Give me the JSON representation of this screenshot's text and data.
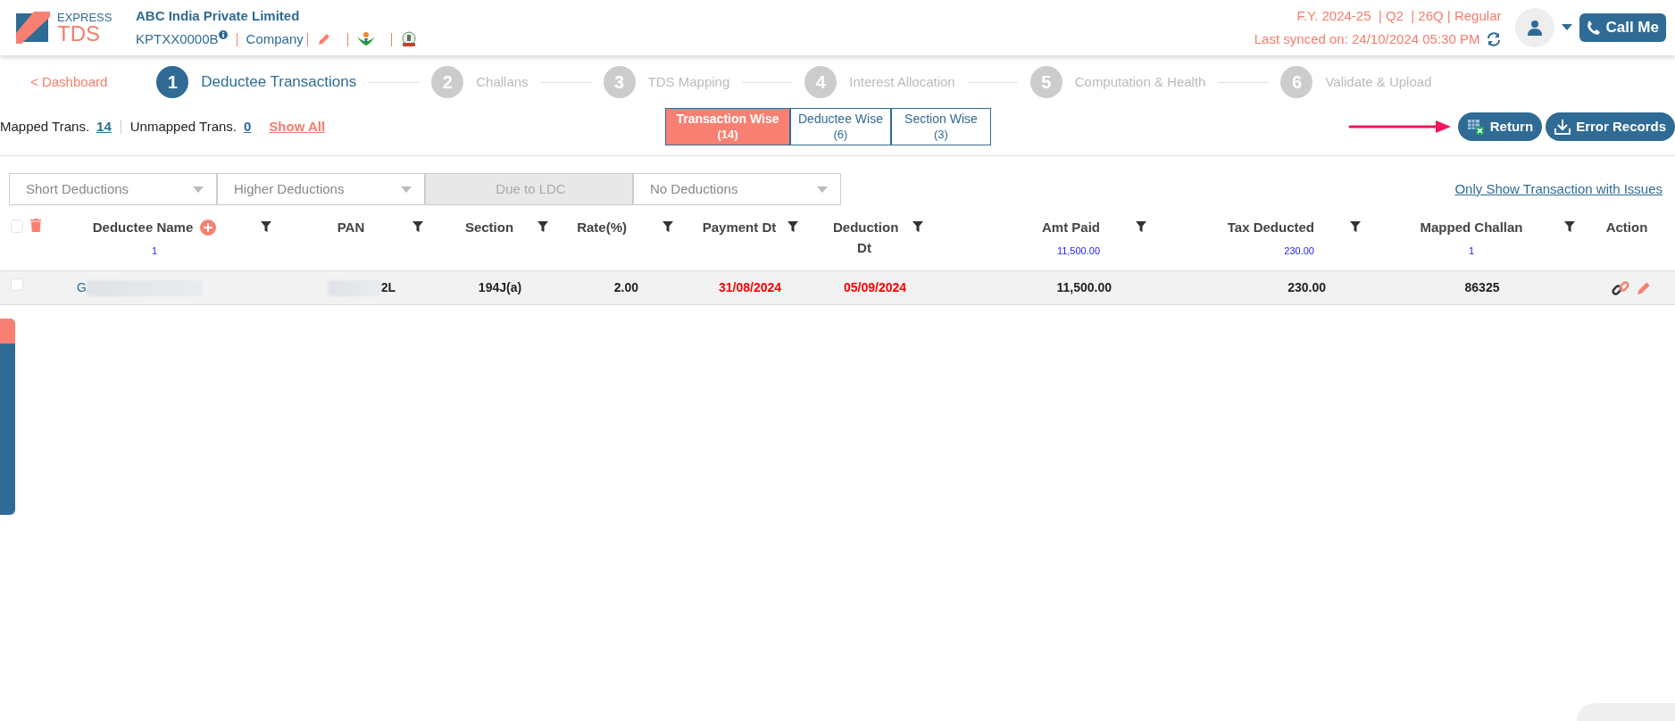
{
  "header": {
    "logo": {
      "top": "EXPRESS",
      "bottom": "TDS"
    },
    "company_name": "ABC India Private Limited",
    "tan": "KPTXX0000B",
    "entity_type": "Company",
    "return_info": "F.Y. 2024-25  | Q2  | 26Q | Regular",
    "last_synced": "Last synced on: 24/10/2024 05:30 PM",
    "call_button": "Call Me"
  },
  "stepper": {
    "back_link": "< Dashboard",
    "steps": [
      {
        "number": "1",
        "label": "Deductee Transactions",
        "selected": true
      },
      {
        "number": "2",
        "label": "Challans",
        "selected": false
      },
      {
        "number": "3",
        "label": "TDS Mapping",
        "selected": false
      },
      {
        "number": "4",
        "label": "Interest Allocation",
        "selected": false
      },
      {
        "number": "5",
        "label": "Computation & Health",
        "selected": false
      },
      {
        "number": "6",
        "label": "Validate & Upload",
        "selected": false
      }
    ]
  },
  "summary": {
    "mapped_label": "Mapped Trans.",
    "mapped_count": "14",
    "unmapped_label": "Unmapped Trans.",
    "unmapped_count": "0",
    "show_all": "Show All"
  },
  "view_tabs": [
    {
      "label": "Transaction Wise",
      "count": "(14)",
      "selected": true
    },
    {
      "label": "Deductee Wise",
      "count": "(6)",
      "selected": false
    },
    {
      "label": "Section Wise",
      "count": "(3)",
      "selected": false
    }
  ],
  "actions": [
    {
      "label": "Return",
      "kind": "excel"
    },
    {
      "label": "Error Records",
      "kind": "download"
    }
  ],
  "filters": [
    {
      "label": "Short Deductions",
      "disabled": false
    },
    {
      "label": "Higher Deductions",
      "disabled": false
    },
    {
      "label": "Due to LDC",
      "disabled": true
    },
    {
      "label": "No Deductions",
      "disabled": false
    }
  ],
  "issues_link": "Only Show Transaction with Issues",
  "table": {
    "select_all_checked": false,
    "columns": [
      {
        "label": "Deductee Name",
        "total": "1",
        "add": true,
        "filter": true
      },
      {
        "label": "PAN",
        "filter": true
      },
      {
        "label": "Section",
        "filter": true
      },
      {
        "label": "Rate(%)",
        "filter": true
      },
      {
        "label": "Payment Dt",
        "filter": true
      },
      {
        "label": "Deduction Dt",
        "filter": true
      },
      {
        "label": "Amt Paid",
        "total": "11,500.00",
        "filter": true
      },
      {
        "label": "Tax Deducted",
        "total": "230.00",
        "filter": true
      },
      {
        "label": "Mapped Challan",
        "total": "1",
        "filter": true
      },
      {
        "label": "Action",
        "filter": false
      }
    ],
    "rows": [
      {
        "checked": false,
        "cells": [
          "G",
          "2L",
          "194J(a)",
          "2.00",
          "31/08/2024",
          "05/09/2024",
          "11,500.00",
          "230.00",
          "86325"
        ]
      }
    ]
  }
}
